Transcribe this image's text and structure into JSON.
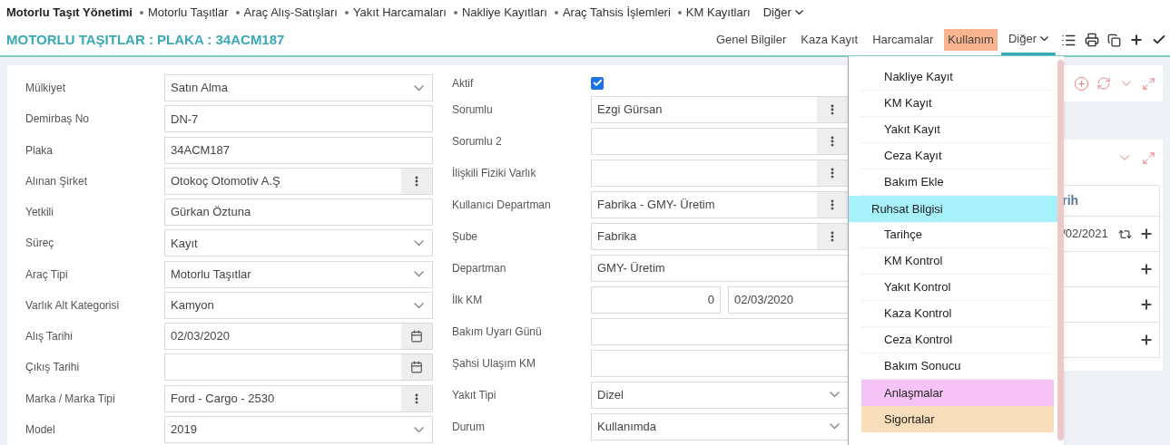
{
  "nav": {
    "title": "Motorlu Taşıt Yönetimi",
    "items": [
      "Motorlu Taşıtlar",
      "Araç Alış-Satışları",
      "Yakıt Harcamaları",
      "Nakliye Kayıtları",
      "Araç Tahsis İşlemleri",
      "KM Kayıtları"
    ],
    "more": "Diğer"
  },
  "header": {
    "title": "MOTORLU TAŞITLAR : PLAKA : 34ACM187",
    "tabs": [
      {
        "label": "Genel Bilgiler",
        "selected": false,
        "dropdown": false
      },
      {
        "label": "Kaza Kayıt",
        "selected": false,
        "dropdown": false
      },
      {
        "label": "Harcamalar",
        "selected": false,
        "dropdown": false
      },
      {
        "label": "Kullanım",
        "selected": false,
        "dropdown": false,
        "color": "#f7b48e"
      },
      {
        "label": "Diğer",
        "selected": true,
        "dropdown": true
      }
    ]
  },
  "form_left": [
    {
      "label": "Mülkiyet",
      "value": "Satın Alma",
      "kind": "select"
    },
    {
      "label": "Demirbaş No",
      "value": "DN-7",
      "kind": "text"
    },
    {
      "label": "Plaka",
      "value": "34ACM187",
      "kind": "text"
    },
    {
      "label": "Alınan Şirket",
      "value": "Otokoç Otomotiv A.Ş",
      "kind": "lookup"
    },
    {
      "label": "Yetkili",
      "value": "Gürkan Öztuna",
      "kind": "text"
    },
    {
      "label": "Süreç",
      "value": "Kayıt",
      "kind": "select"
    },
    {
      "label": "Araç Tipi",
      "value": "Motorlu Taşıtlar",
      "kind": "select"
    },
    {
      "label": "Varlık Alt Kategorisi",
      "value": "Kamyon",
      "kind": "select"
    },
    {
      "label": "Alış Tarihi",
      "value": "02/03/2020",
      "kind": "date"
    },
    {
      "label": "Çıkış Tarihi",
      "kind": "date"
    },
    {
      "label": "Marka / Marka Tipi",
      "value": "Ford - Cargo - 2530",
      "kind": "lookup"
    },
    {
      "label": "Model",
      "value": "2019",
      "kind": "select"
    }
  ],
  "form_right": [
    {
      "label": "Aktif",
      "kind": "checkbox",
      "checked": true
    },
    {
      "label": "Sorumlu",
      "value": "Ezgi Gürsan",
      "kind": "lookup"
    },
    {
      "label": "Sorumlu 2",
      "kind": "lookup"
    },
    {
      "label": "İlişkili Fiziki Varlık",
      "kind": "lookup"
    },
    {
      "label": "Kullanıcı Departman",
      "value": "Fabrika - GMY- Üretim",
      "kind": "lookup"
    },
    {
      "label": "Şube",
      "value": "Fabrika",
      "kind": "lookup"
    },
    {
      "label": "Departman",
      "value": "GMY- Üretim",
      "kind": "text"
    },
    {
      "label": "İlk KM",
      "value": "0",
      "value_2": "02/03/2020",
      "kind": "pair"
    },
    {
      "label": "Bakım Uyarı Günü",
      "kind": "text"
    },
    {
      "label": "Şahsi Ulaşım KM",
      "kind": "text"
    },
    {
      "label": "Yakıt Tipi",
      "value": "Dizel",
      "kind": "select"
    },
    {
      "label": "Durum",
      "value": "Kullanımda",
      "kind": "select"
    }
  ],
  "side_panel": {
    "table_header": "rih",
    "rows": [
      {
        "date": "/02/2021"
      },
      {},
      {},
      {}
    ]
  },
  "menu": [
    {
      "label": "Nakliye Kayıt"
    },
    {
      "label": "KM Kayıt"
    },
    {
      "label": "Yakıt Kayıt"
    },
    {
      "label": "Ceza Kayıt"
    },
    {
      "label": "Bakım Ekle"
    },
    {
      "label": "Ruhsat Bilgisi",
      "color": "#a6f0fa"
    },
    {
      "label": "Tarihçe"
    },
    {
      "label": "KM Kontrol"
    },
    {
      "label": "Yakıt Kontrol"
    },
    {
      "label": "Kaza Kontrol"
    },
    {
      "label": "Ceza Kontrol"
    },
    {
      "label": "Bakım Sonucu"
    },
    {
      "label": "Anlaşmalar",
      "color": "#f5c3f5"
    },
    {
      "label": "Sigortalar",
      "color": "#f7ddb9"
    }
  ]
}
